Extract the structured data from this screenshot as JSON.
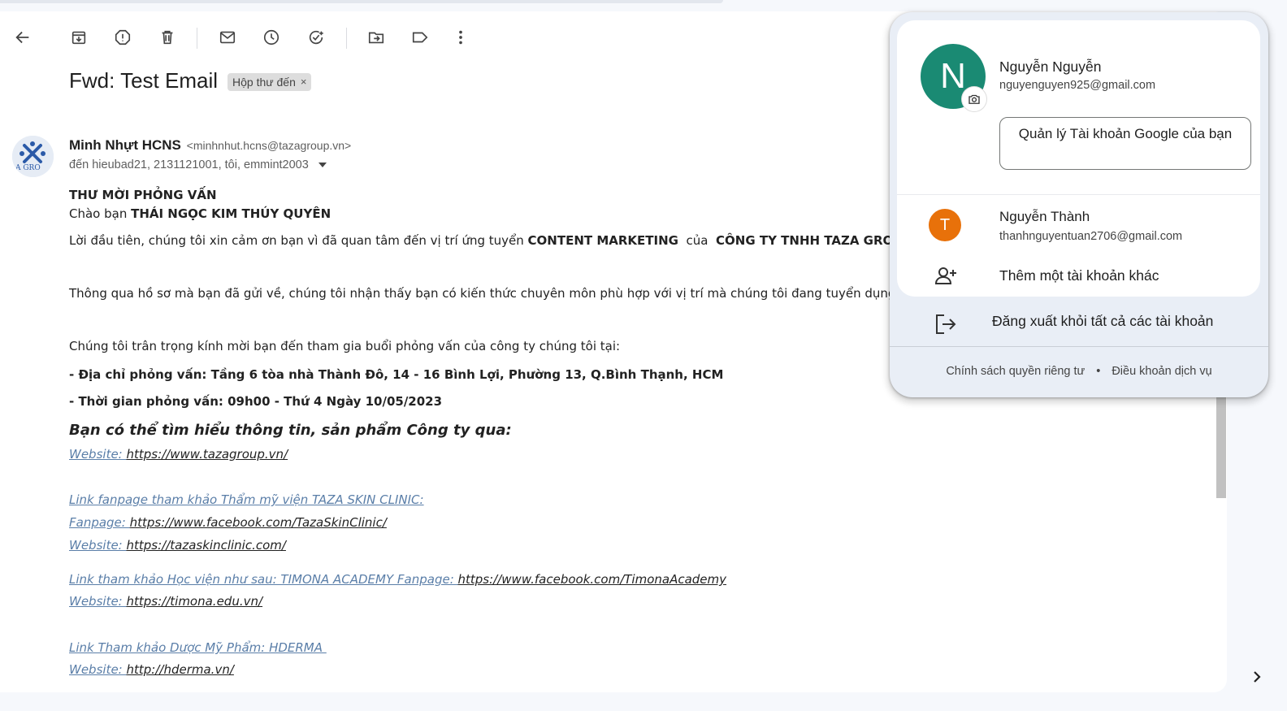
{
  "toolbar": {
    "icons": [
      "back-arrow-icon",
      "archive-icon",
      "report-spam-icon",
      "delete-icon",
      "mark-unread-icon",
      "snooze-icon",
      "add-to-tasks-icon",
      "move-to-icon",
      "label-icon",
      "more-vert-icon"
    ]
  },
  "email": {
    "subject": "Fwd: Test Email",
    "label_chip": "Hộp thư đến",
    "label_chip_remove": "×",
    "sender_name": "Minh Nhựt HCNS",
    "sender_email": "<minhnhut.hcns@tazagroup.vn>",
    "to_line": "đến hieubad21, 2131121001, tôi, emmint2003",
    "avatar_text": "A GRO",
    "body": {
      "heading": "THƯ MỜI PHỎNG VẤN",
      "greeting_prefix": "Chào bạn ",
      "greeting_name": "THÁI NGỌC KIM THÚY QUYÊN",
      "p1_prefix": "Lời đầu tiên, chúng tôi xin cảm ơn bạn vì đã quan tâm đến vị trí ứng tuyển ",
      "p1_position": "CONTENT MARKETING",
      "p1_mid": "  của  ",
      "p1_company": "CÔNG TY TNHH TAZA GROUP",
      "p2": "Thông qua hồ sơ mà bạn đã gửi về, chúng tôi nhận thấy bạn có kiến thức chuyên môn phù hợp với vị trí mà chúng tôi đang tuyển dụng.",
      "p3": "Chúng tôi trân trọng kính mời bạn đến tham gia buổi phỏng vấn của công ty chúng tôi tại:",
      "address": "-  Địa chỉ phỏng vấn: Tầng 6 tòa nhà Thành Đô, 14 - 16 Bình Lợi, Phường 13, Q.Bình Thạnh, HCM",
      "time": "- Thời gian phỏng vấn: 09h00 - Thứ 4 Ngày 10/05/2023",
      "info_heading": "Bạn có thể tìm hiểu thông tin, sản phẩm Công ty qua:",
      "links": [
        {
          "label": "Website: ",
          "url": "https://www.tazagroup.vn/"
        },
        {
          "label": "Link fanpage tham khảo Thẩm mỹ viện TAZA SKIN CLINIC:",
          "url": ""
        },
        {
          "label": "Fanpage: ",
          "url": "https://www.facebook.com/TazaSkinClinic/"
        },
        {
          "label": "Website: ",
          "url": "https://tazaskinclinic.com/"
        },
        {
          "label": "Link tham khảo Học viện như sau: TIMONA ACADEMY Fanpage: ",
          "url": "https://www.facebook.com/TimonaAcademy"
        },
        {
          "label": "Website: ",
          "url": "https://timona.edu.vn/"
        },
        {
          "label": "Link Tham khảo Dược Mỹ Phẩm: HDERMA ",
          "url": ""
        },
        {
          "label": "Website: ",
          "url": "http://hderma.vn/"
        }
      ]
    }
  },
  "account_panel": {
    "avatar_letter": "N",
    "avatar_color": "#1a8a73",
    "name": "Nguyễn Nguyễn",
    "email": "nguyenguyen925@gmail.com",
    "manage_button": "Quản lý Tài khoản Google của bạn",
    "other_account": {
      "avatar_letter": "T",
      "avatar_color": "#e8710a",
      "name": "Nguyễn Thành",
      "email": "thanhnguyentuan2706@gmail.com"
    },
    "add_account": "Thêm một tài khoản khác",
    "sign_out": "Đăng xuất khỏi tất cả các tài khoản",
    "privacy": "Chính sách quyền riêng tư",
    "separator": "•",
    "terms": "Điều khoản dịch vụ"
  }
}
